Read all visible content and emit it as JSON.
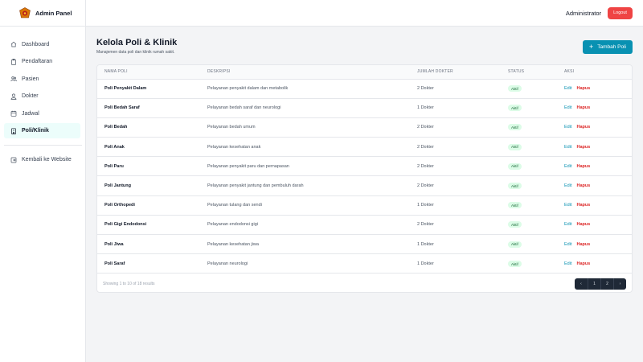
{
  "brand": {
    "name": "Admin Panel"
  },
  "sidebar": {
    "items": [
      {
        "label": "Dashboard",
        "icon": "home-icon"
      },
      {
        "label": "Pendaftaran",
        "icon": "clipboard-icon"
      },
      {
        "label": "Pasien",
        "icon": "users-icon"
      },
      {
        "label": "Dokter",
        "icon": "doctor-icon"
      },
      {
        "label": "Jadwal",
        "icon": "calendar-icon"
      },
      {
        "label": "Poli/Klinik",
        "icon": "building-icon",
        "active": true
      }
    ],
    "back_label": "Kembali ke Website"
  },
  "topbar": {
    "user": "Administrator",
    "logout_label": "Logout"
  },
  "main": {
    "title": "Kelola Poli & Klinik",
    "subtitle": "Manajemen data poli dan klinik rumah sakit.",
    "add_button_label": "Tambah Poli"
  },
  "table": {
    "headers": [
      "NAMA POLI",
      "DESKRIPSI",
      "JUMLAH DOKTER",
      "STATUS",
      "AKSI"
    ],
    "rows": [
      {
        "name": "Poli Penyakit Dalam",
        "desc": "Pelayanan penyakit dalam dan metabolik",
        "doctors": "2 Dokter",
        "status": "Aktif"
      },
      {
        "name": "Poli Bedah Saraf",
        "desc": "Pelayanan bedah saraf dan neurologi",
        "doctors": "1 Dokter",
        "status": "Aktif"
      },
      {
        "name": "Poli Bedah",
        "desc": "Pelayanan bedah umum",
        "doctors": "2 Dokter",
        "status": "Aktif"
      },
      {
        "name": "Poli Anak",
        "desc": "Pelayanan kesehatan anak",
        "doctors": "2 Dokter",
        "status": "Aktif"
      },
      {
        "name": "Poli Paru",
        "desc": "Pelayanan penyakit paru dan pernapasan",
        "doctors": "2 Dokter",
        "status": "Aktif"
      },
      {
        "name": "Poli Jantung",
        "desc": "Pelayanan penyakit jantung dan pembuluh darah",
        "doctors": "2 Dokter",
        "status": "Aktif"
      },
      {
        "name": "Poli Orthopedi",
        "desc": "Pelayanan tulang dan sendi",
        "doctors": "1 Dokter",
        "status": "Aktif"
      },
      {
        "name": "Poli Gigi Endodonsi",
        "desc": "Pelayanan endodonsi gigi",
        "doctors": "2 Dokter",
        "status": "Aktif"
      },
      {
        "name": "Poli Jiwa",
        "desc": "Pelayanan kesehatan jiwa",
        "doctors": "1 Dokter",
        "status": "Aktif"
      },
      {
        "name": "Poli Saraf",
        "desc": "Pelayanan neurologi",
        "doctors": "1 Dokter",
        "status": "Aktif"
      }
    ],
    "edit_label": "Edit",
    "delete_label": "Hapus"
  },
  "pagination": {
    "results_text": "Showing 1 to 10 of 18 results",
    "prev": "‹",
    "pages": [
      "1",
      "2"
    ],
    "next": "›"
  },
  "colors": {
    "accent": "#0891b2",
    "danger": "#ef4444",
    "status_bg": "#dcfce7"
  }
}
